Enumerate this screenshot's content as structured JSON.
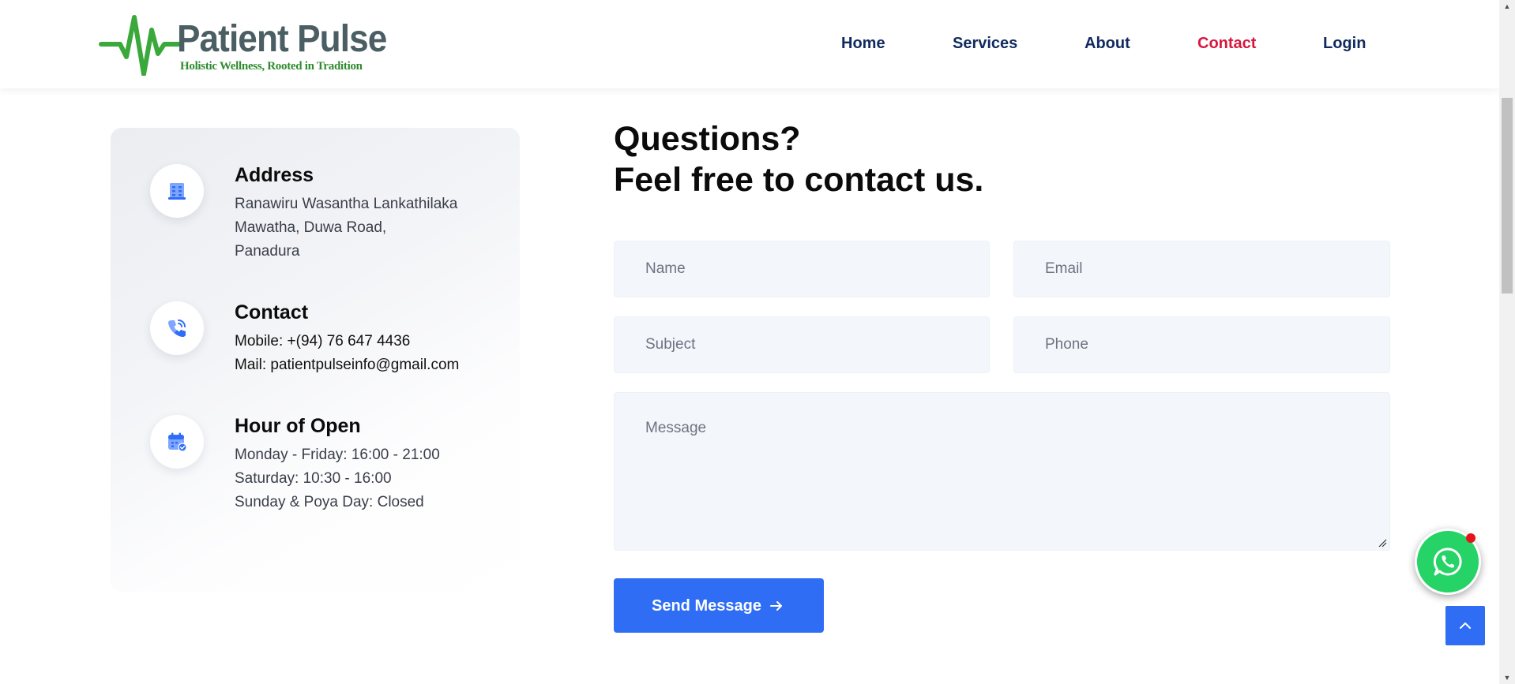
{
  "brand": {
    "name": "Patient Pulse",
    "tagline": "Holistic Wellness, Rooted in Tradition"
  },
  "nav": {
    "items": [
      {
        "label": "Home"
      },
      {
        "label": "Services"
      },
      {
        "label": "About"
      },
      {
        "label": "Contact",
        "active": true
      },
      {
        "label": "Login"
      }
    ]
  },
  "info": {
    "address": {
      "title": "Address",
      "lines": [
        "Ranawiru Wasantha Lankathilaka",
        "Mawatha, Duwa Road,",
        "Panadura"
      ],
      "icon": "building-icon"
    },
    "contact": {
      "title": "Contact",
      "mobile": "Mobile: +(94) 76 647 4436",
      "mail": "Mail: patientpulseinfo@gmail.com",
      "icon": "phone-icon"
    },
    "hours": {
      "title": "Hour of Open",
      "lines": [
        "Monday - Friday: 16:00 - 21:00",
        "Saturday: 10:30 - 16:00",
        "Sunday & Poya Day: Closed"
      ],
      "icon": "calendar-icon"
    }
  },
  "form": {
    "heading_line1": "Questions?",
    "heading_line2": "Feel free to contact us.",
    "name": {
      "value": "",
      "placeholder": "Name"
    },
    "email": {
      "value": "",
      "placeholder": "Email"
    },
    "subject": {
      "value": "",
      "placeholder": "Subject"
    },
    "phone": {
      "value": "",
      "placeholder": "Phone"
    },
    "message": {
      "value": "",
      "placeholder": "Message"
    },
    "submit_label": "Send Message"
  },
  "widgets": {
    "whatsapp_icon": "whatsapp-icon",
    "back_to_top_icon": "chevron-up-icon"
  },
  "colors": {
    "nav_text": "#102a5e",
    "nav_active": "#d8173f",
    "primary_button": "#2f6df5",
    "whatsapp_green": "#25d366",
    "field_background": "#f3f6fb",
    "logo_green": "#2e8b2e",
    "logo_grey": "#4b5e63"
  }
}
